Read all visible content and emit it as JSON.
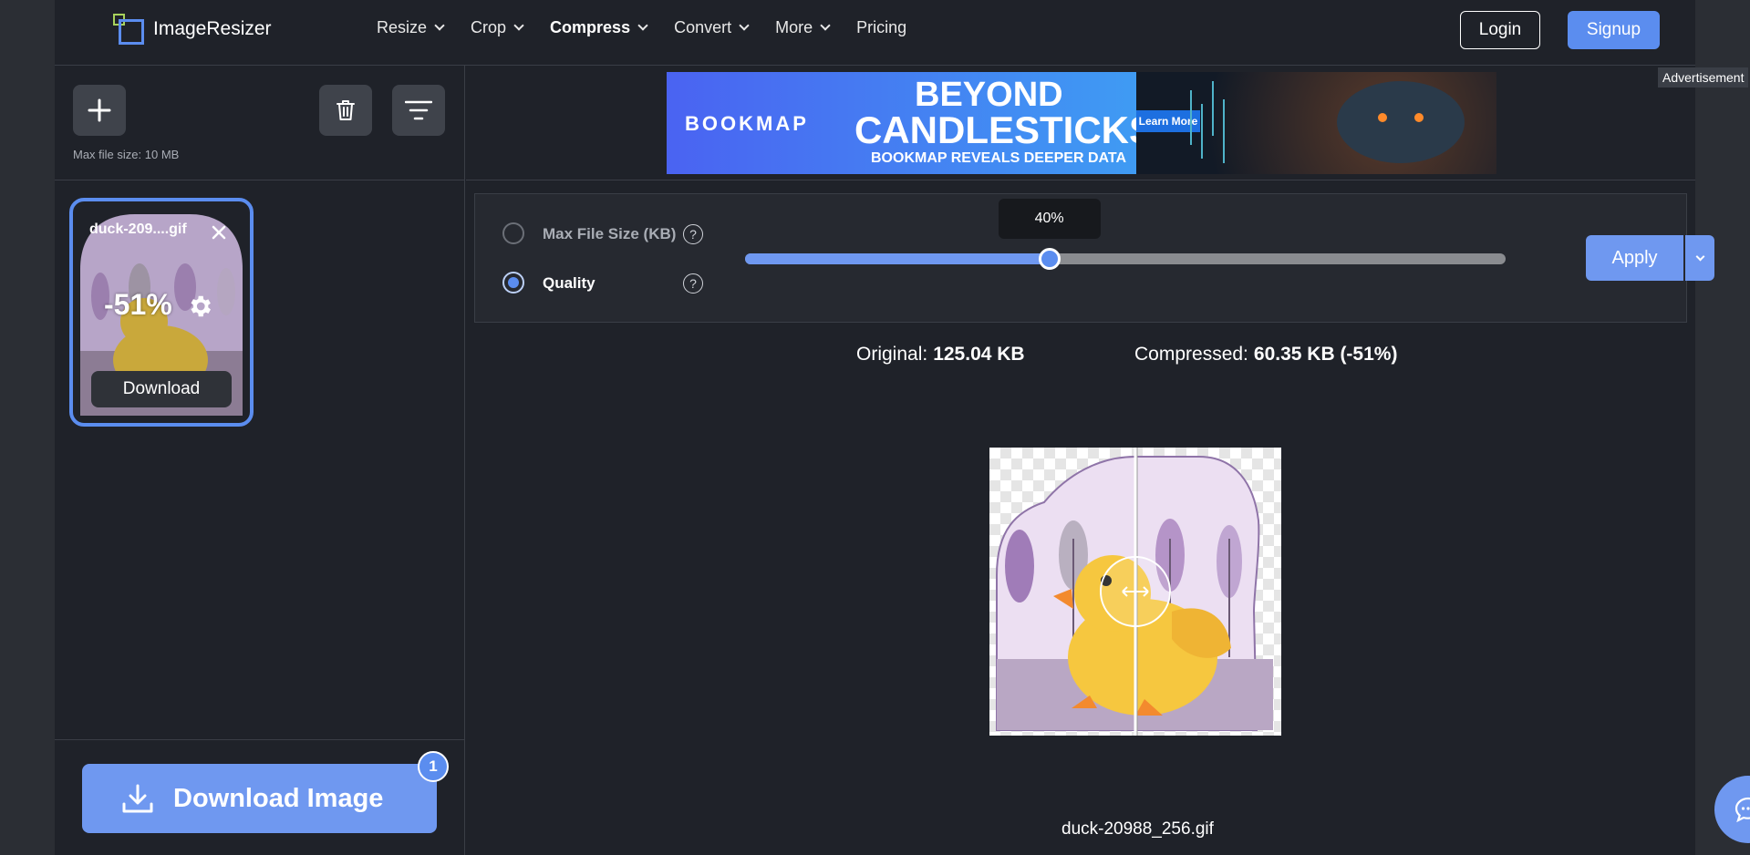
{
  "header": {
    "brand": "ImageResizer",
    "nav": [
      {
        "label": "Resize",
        "dropdown": true,
        "active": false
      },
      {
        "label": "Crop",
        "dropdown": true,
        "active": false
      },
      {
        "label": "Compress",
        "dropdown": true,
        "active": true
      },
      {
        "label": "Convert",
        "dropdown": true,
        "active": false
      },
      {
        "label": "More",
        "dropdown": true,
        "active": false
      },
      {
        "label": "Pricing",
        "dropdown": false,
        "active": false
      }
    ],
    "login_label": "Login",
    "signup_label": "Signup"
  },
  "toolbar": {
    "add_icon": "plus-icon",
    "delete_icon": "trash-icon",
    "filter_icon": "filter-icon",
    "max_file_size": "Max file size: 10 MB"
  },
  "file_card": {
    "name": "duck-209....gif",
    "reduction": "-51%",
    "download_label": "Download"
  },
  "download_all": {
    "label": "Download Image",
    "count": "1"
  },
  "ad": {
    "brand": "BOOKMAP",
    "headline_1": "BEYOND",
    "headline_2": "CANDLESTICKS",
    "subline": "BOOKMAP REVEALS DEEPER DATA",
    "cta": "Learn More",
    "label": "Advertisement"
  },
  "settings": {
    "option_max_size": "Max File Size (KB)",
    "option_quality": "Quality",
    "selected": "quality",
    "quality_percent": 40,
    "quality_label": "40%",
    "apply_label": "Apply"
  },
  "result": {
    "original_label": "Original:",
    "original_value": "125.04 KB",
    "compressed_label": "Compressed:",
    "compressed_value": "60.35 KB (-51%)",
    "filename": "duck-20988_256.gif"
  },
  "colors": {
    "accent": "#5b8def",
    "background": "#1f2229",
    "panel": "#262930"
  }
}
